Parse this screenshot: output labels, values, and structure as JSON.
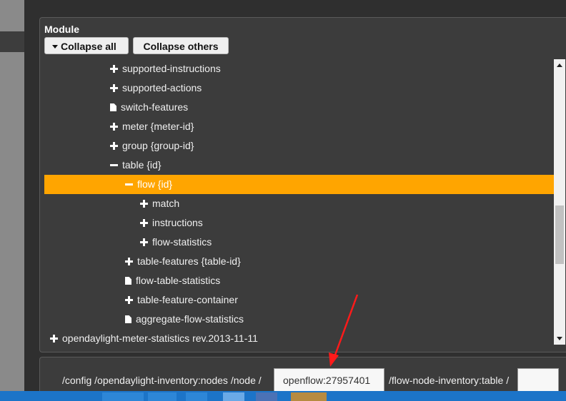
{
  "module": {
    "title": "Module",
    "collapse_all_label": "Collapse all",
    "collapse_others_label": "Collapse others"
  },
  "tree": [
    {
      "label": "supported-instructions",
      "icon": "plus-icon",
      "selected": false
    },
    {
      "label": "supported-actions",
      "icon": "plus-icon",
      "selected": false
    },
    {
      "label": "switch-features",
      "icon": "file-icon",
      "selected": false
    },
    {
      "label": "meter {meter-id}",
      "icon": "plus-icon",
      "selected": false
    },
    {
      "label": "group {group-id}",
      "icon": "plus-icon",
      "selected": false
    },
    {
      "label": "table {id}",
      "icon": "minus-icon",
      "selected": false
    },
    {
      "label": "flow {id}",
      "icon": "minus-icon",
      "selected": true
    },
    {
      "label": "match",
      "icon": "plus-icon",
      "selected": false
    },
    {
      "label": "instructions",
      "icon": "plus-icon",
      "selected": false
    },
    {
      "label": "flow-statistics",
      "icon": "plus-icon",
      "selected": false
    },
    {
      "label": "table-features {table-id}",
      "icon": "plus-icon",
      "selected": false
    },
    {
      "label": "flow-table-statistics",
      "icon": "file-icon",
      "selected": false
    },
    {
      "label": "table-feature-container",
      "icon": "plus-icon",
      "selected": false
    },
    {
      "label": "aggregate-flow-statistics",
      "icon": "file-icon",
      "selected": false
    },
    {
      "label": "opendaylight-meter-statistics rev.2013-11-11",
      "icon": "plus-icon",
      "selected": false
    }
  ],
  "path": {
    "segment_1": "/config /opendaylight-inventory:nodes /node /",
    "node_value": "openflow:27957401",
    "segment_2": "/flow-node-inventory:table /"
  },
  "colors": {
    "selected_row": "#ffa500",
    "panel_bg": "#3c3c3c"
  }
}
